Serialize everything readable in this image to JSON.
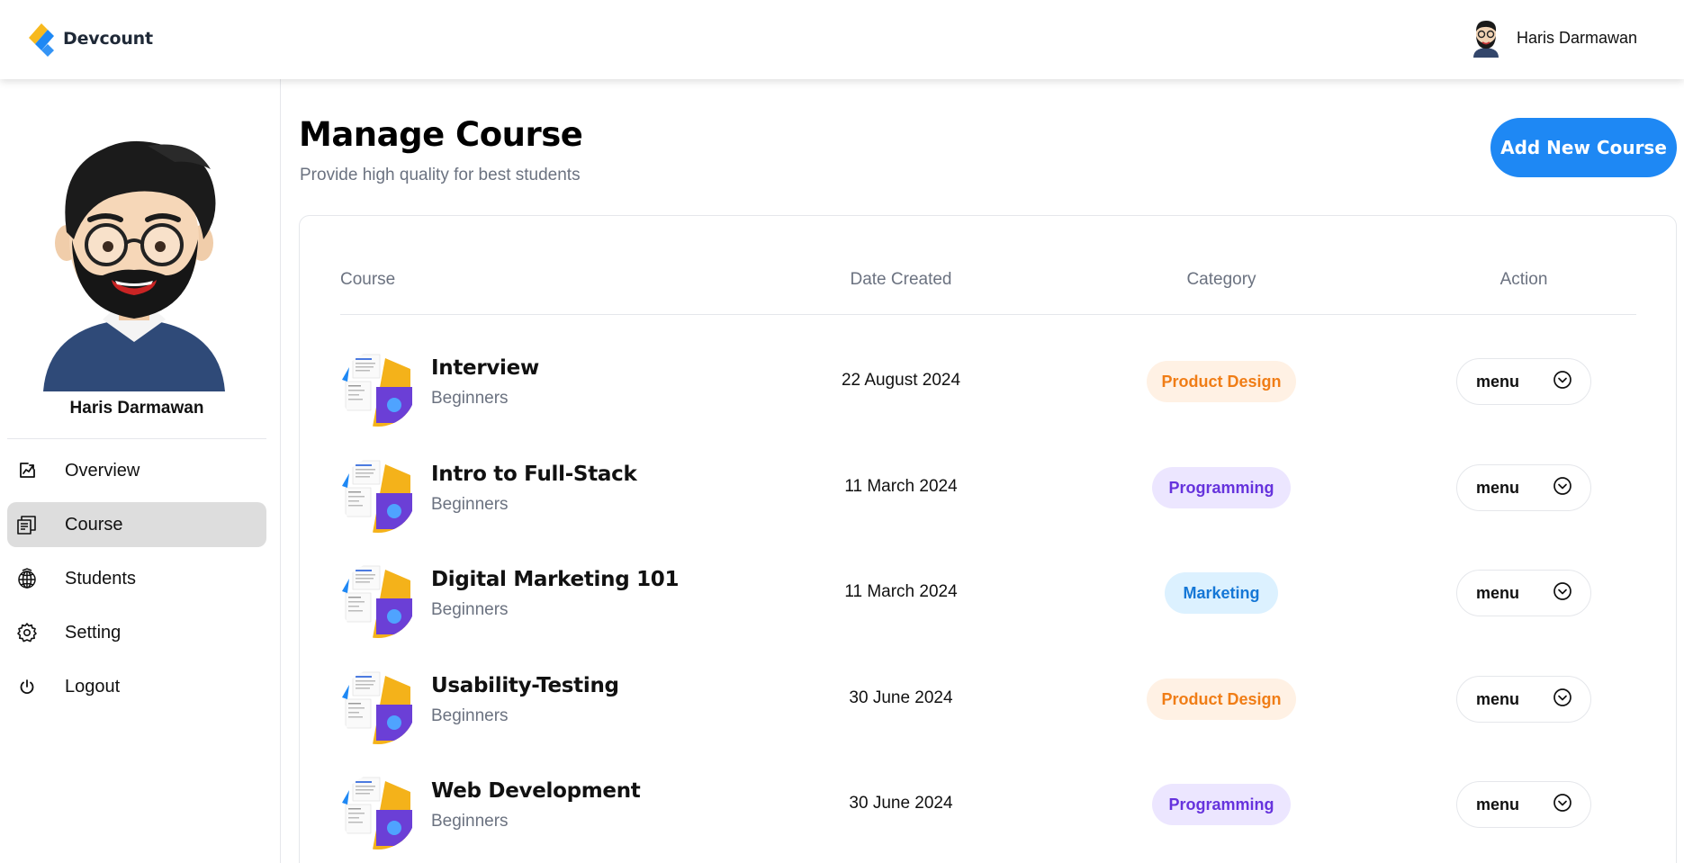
{
  "brand": {
    "name": "Devcount"
  },
  "topbar": {
    "username": "Haris Darmawan"
  },
  "sidebar": {
    "username": "Haris Darmawan",
    "items": [
      {
        "label": "Overview",
        "icon": "chart-icon",
        "active": false
      },
      {
        "label": "Course",
        "icon": "courses-icon",
        "active": true
      },
      {
        "label": "Students",
        "icon": "students-icon",
        "active": false
      },
      {
        "label": "Setting",
        "icon": "gear-icon",
        "active": false
      },
      {
        "label": "Logout",
        "icon": "power-icon",
        "active": false
      }
    ]
  },
  "main": {
    "title": "Manage Course",
    "subtitle": "Provide high quality for best students",
    "add_button_label": "Add New Course"
  },
  "table": {
    "headers": {
      "course": "Course",
      "date": "Date Created",
      "category": "Category",
      "action": "Action"
    },
    "rows": [
      {
        "title": "Interview",
        "level": "Beginners",
        "date": "22 August 2024",
        "category": "Product Design",
        "menu": "menu"
      },
      {
        "title": "Intro to Full-Stack",
        "level": "Beginners",
        "date": "11 March 2024",
        "category": "Programming",
        "menu": "menu"
      },
      {
        "title": "Digital Marketing 101",
        "level": "Beginners",
        "date": "11 March 2024",
        "category": "Marketing",
        "menu": "menu"
      },
      {
        "title": "Usability-Testing",
        "level": "Beginners",
        "date": "30 June 2024",
        "category": "Product Design",
        "menu": "menu"
      },
      {
        "title": "Web Development",
        "level": "Beginners",
        "date": "30 June 2024",
        "category": "Programming",
        "menu": "menu"
      }
    ]
  },
  "colors": {
    "accent": "#1e88f4",
    "product_design_bg": "#fff1e4",
    "product_design_fg": "#f07d16",
    "programming_bg": "#ece6ff",
    "programming_fg": "#6633dd",
    "marketing_bg": "#dcf1ff",
    "marketing_fg": "#1577d6"
  }
}
